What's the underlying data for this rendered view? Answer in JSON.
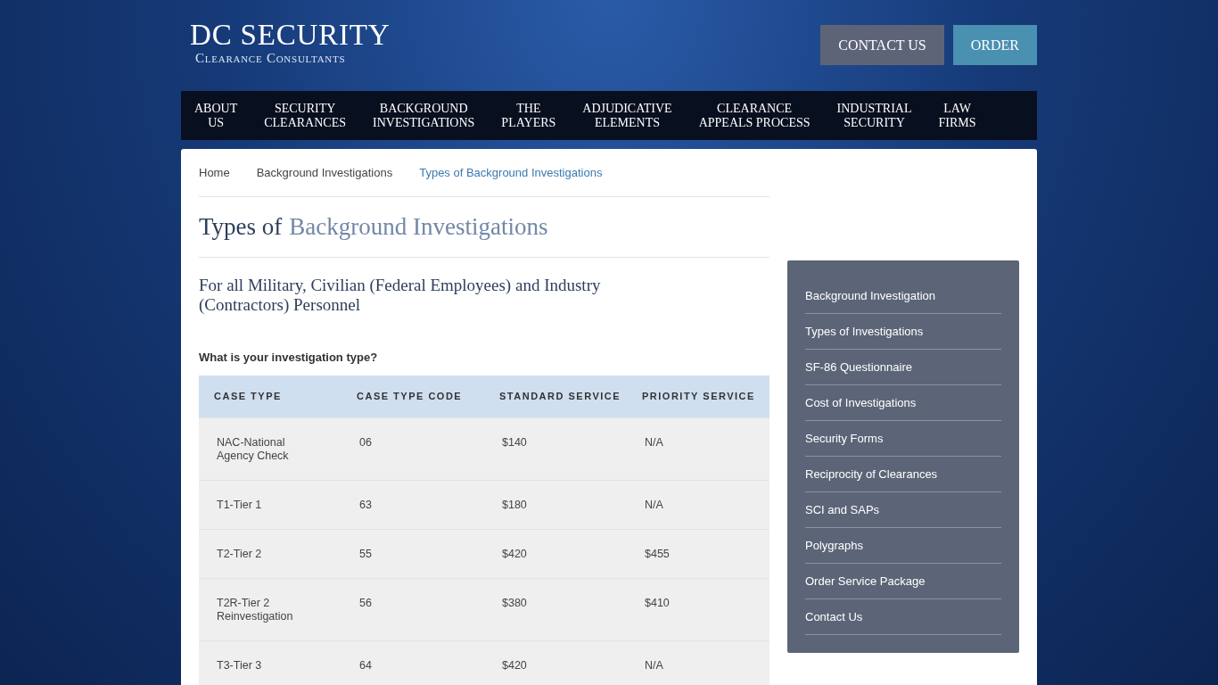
{
  "logo": {
    "title": "DC SECURITY",
    "subtitle": "Clearance Consultants"
  },
  "header_buttons": [
    {
      "label": "CONTACT US",
      "kind": "secondary"
    },
    {
      "label": "ORDER",
      "kind": "primary"
    }
  ],
  "nav": [
    {
      "lines": [
        "ABOUT",
        "US"
      ]
    },
    {
      "lines": [
        "SECURITY",
        "CLEARANCES"
      ]
    },
    {
      "lines": [
        "BACKGROUND",
        "INVESTIGATIONS"
      ]
    },
    {
      "lines": [
        "THE",
        "PLAYERS"
      ]
    },
    {
      "lines": [
        "ADJUDICATIVE",
        "ELEMENTS"
      ]
    },
    {
      "lines": [
        "CLEARANCE",
        "APPEALS PROCESS"
      ]
    },
    {
      "lines": [
        "INDUSTRIAL",
        "SECURITY"
      ]
    },
    {
      "lines": [
        "LAW",
        "FIRMS"
      ]
    }
  ],
  "breadcrumb": [
    {
      "label": "Home",
      "selected": false
    },
    {
      "label": "Background Investigations",
      "selected": false
    },
    {
      "label": "Types of Background Investigations",
      "selected": true
    }
  ],
  "page_title": {
    "lead": "Types of",
    "accent": "Background Investigations"
  },
  "subtitle": "For all Military, Civilian (Federal Employees) and Industry (Contractors) Personnel",
  "question": "What is your investigation type?",
  "table": {
    "columns": [
      "CASE TYPE",
      "CASE TYPE CODE",
      "STANDARD SERVICE",
      "PRIORITY SERVICE"
    ],
    "rows": [
      [
        "NAC-National Agency Check",
        "06",
        "$140",
        "N/A"
      ],
      [
        "T1-Tier 1",
        "63",
        "$180",
        "N/A"
      ],
      [
        "T2-Tier 2",
        "55",
        "$420",
        "$455"
      ],
      [
        "T2R-Tier 2 Reinvestigation",
        "56",
        "$380",
        "$410"
      ],
      [
        "T3-Tier 3",
        "64",
        "$420",
        "N/A"
      ]
    ]
  },
  "sidebar": {
    "items": [
      "Background Investigation",
      "Types of Investigations",
      "SF-86 Questionnaire",
      "Cost of Investigations",
      "Security Forms",
      "Reciprocity of Clearances",
      "SCI and SAPs",
      "Polygraphs",
      "Order Service Package",
      "Contact Us"
    ]
  }
}
